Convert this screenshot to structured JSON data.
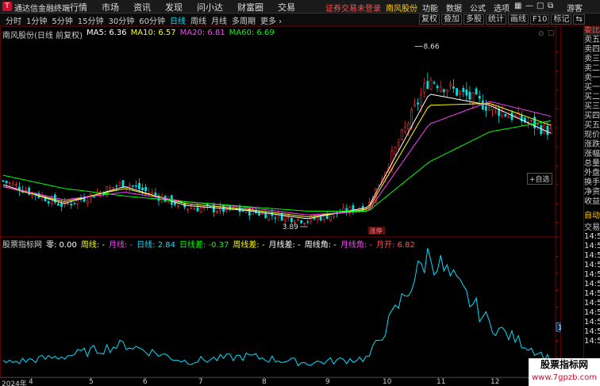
{
  "app": {
    "name": "通达信金融终端",
    "menu": [
      "行情",
      "市场",
      "资讯",
      "发现",
      "问小达",
      "财富圈",
      "交易"
    ],
    "notice": "证券交易未登录",
    "current_stock": "南风股份",
    "right_menu": [
      "功能",
      "数据",
      "公式",
      "选项"
    ],
    "user": "游客"
  },
  "periods": {
    "items": [
      "分时",
      "1分钟",
      "5分钟",
      "15分钟",
      "30分钟",
      "60分钟",
      "日线",
      "周线",
      "月线",
      "多周期",
      "更多 ›"
    ],
    "active": "日线"
  },
  "tools": [
    "复权",
    "叠加",
    "多股",
    "统计",
    "画线",
    "F10",
    "标记",
    "⇆"
  ],
  "ma_legend": {
    "title": "南风股份(日线 前复权)",
    "items": [
      {
        "label": "MA5: 6.36",
        "color": "#ffffff"
      },
      {
        "label": "MA10: 6.57",
        "color": "#ffff00"
      },
      {
        "label": "MA20: 6.81",
        "color": "#ff40ff"
      },
      {
        "label": "MA60: 6.69",
        "color": "#00ff00"
      }
    ]
  },
  "indicator_legend": {
    "title": "股票指标网",
    "items": [
      {
        "label": "零: 0.00",
        "color": "#ffffff"
      },
      {
        "label": "周线: -",
        "color": "#ffff00"
      },
      {
        "label": "月线: -",
        "color": "#ff40ff"
      },
      {
        "label": "日线: 2.84",
        "color": "#00e0ff"
      },
      {
        "label": "日线差: -0.37",
        "color": "#00ff00"
      },
      {
        "label": "周线差: -",
        "color": "#ffff00"
      },
      {
        "label": "月线差: -",
        "color": "#ffffff"
      },
      {
        "label": "周线角: -",
        "color": "#ffffff"
      },
      {
        "label": "月线角: -",
        "color": "#ff40ff"
      },
      {
        "label": "月开: 6.82",
        "color": "#ff5050"
      }
    ]
  },
  "right_panel": {
    "labels": [
      "委比",
      "卖五",
      "卖四",
      "卖三",
      "卖二",
      "卖一",
      "买一",
      "买二",
      "买三",
      "买四",
      "买五",
      "现价",
      "涨跌",
      "涨幅",
      "总量",
      "外盘",
      "换手",
      "净资",
      "收益"
    ],
    "auto": "自动",
    "trade": "交易",
    "ticks": [
      "14:5",
      "14:5",
      "14:5",
      "14:5",
      "14:5",
      "14:5",
      "14:5",
      "14:5",
      "14:5",
      "14:5",
      "14:5",
      "14:5"
    ]
  },
  "auto_select": "+自选",
  "limit_up_tag": "涨停",
  "annotations": {
    "high": "8.66",
    "low": "3.89"
  },
  "x_axis": [
    "2024年",
    "4",
    "5",
    "6",
    "7",
    "8",
    "9",
    "10",
    "11",
    "12"
  ],
  "chart_data": [
    {
      "type": "candlestick",
      "title": "南风股份(日线 前复权)",
      "y_ticks": [
        8.5,
        8.0,
        7.5,
        7.0,
        6.5,
        6.0,
        5.5,
        5.0,
        4.5,
        4.0
      ],
      "ylim": [
        3.7,
        8.9
      ],
      "x": [
        "2024-03",
        "2024-04",
        "2024-05",
        "2024-06",
        "2024-07",
        "2024-08",
        "2024-09",
        "2024-10",
        "2024-11",
        "2024-12"
      ],
      "close": [
        5.1,
        4.45,
        5.05,
        4.4,
        4.3,
        4.05,
        4.45,
        7.8,
        7.05,
        6.4
      ],
      "open": [
        4.9,
        4.7,
        4.8,
        4.7,
        4.4,
        4.2,
        4.2,
        4.9,
        7.4,
        6.9
      ],
      "high": [
        5.3,
        4.9,
        5.4,
        4.8,
        4.5,
        4.3,
        4.6,
        8.66,
        7.5,
        7.1
      ],
      "low": [
        4.7,
        4.2,
        4.5,
        4.2,
        4.1,
        3.89,
        4.1,
        4.8,
        6.7,
        6.2
      ],
      "series": [
        {
          "name": "MA5",
          "color": "#ffffff",
          "values": [
            5.0,
            4.5,
            4.95,
            4.45,
            4.32,
            4.1,
            4.4,
            7.4,
            7.1,
            6.36
          ]
        },
        {
          "name": "MA10",
          "color": "#ffff00",
          "values": [
            4.95,
            4.55,
            4.9,
            4.5,
            4.35,
            4.15,
            4.35,
            7.1,
            7.15,
            6.57
          ]
        },
        {
          "name": "MA20",
          "color": "#ff40ff",
          "values": [
            4.95,
            4.6,
            4.8,
            4.55,
            4.4,
            4.2,
            4.3,
            6.6,
            7.2,
            6.81
          ]
        },
        {
          "name": "MA60",
          "color": "#00ff00",
          "values": [
            5.25,
            4.9,
            4.7,
            4.55,
            4.42,
            4.3,
            4.3,
            5.6,
            6.4,
            6.69
          ]
        }
      ]
    },
    {
      "type": "line",
      "title": "股票指标网",
      "y_ticks": [
        40.0,
        35.0,
        30.0,
        25.0,
        20.0,
        15.0,
        10.0
      ],
      "ylim": [
        5,
        42.5
      ],
      "current_value": "19.04",
      "x": [
        "2024-03",
        "2024-04",
        "2024-05",
        "2024-06",
        "2024-07",
        "2024-08",
        "2024-09",
        "2024-10",
        "2024-11",
        "2024-12"
      ],
      "series": [
        {
          "name": "日线",
          "color": "#00e0ff",
          "values": [
            8.5,
            10.5,
            14.0,
            9.0,
            10.5,
            8.5,
            10.0,
            41.0,
            20.0,
            9.5
          ]
        }
      ]
    }
  ]
}
